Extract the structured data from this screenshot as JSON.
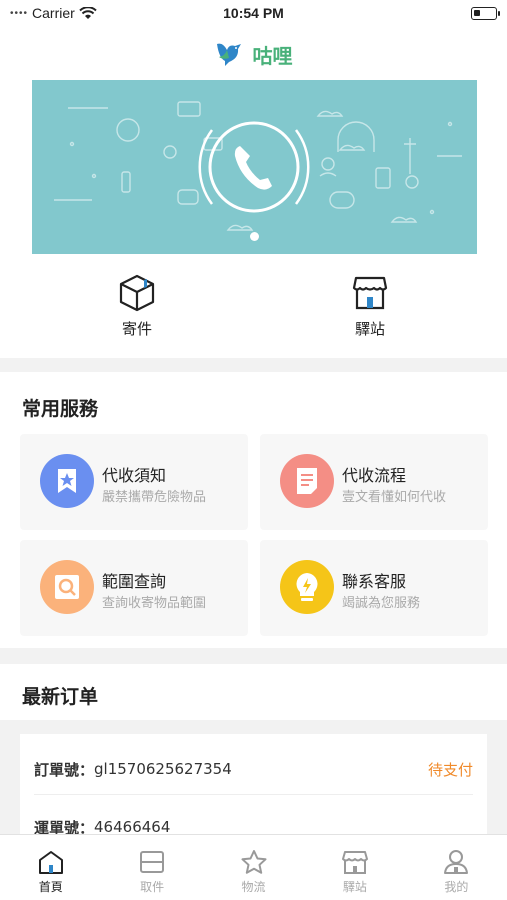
{
  "status_bar": {
    "carrier": "Carrier",
    "time": "10:54 PM"
  },
  "header": {
    "title": "咕哩",
    "logo_icon": "bird-logo-icon"
  },
  "quick_actions": [
    {
      "label": "寄件",
      "icon": "package-box-icon"
    },
    {
      "label": "驛站",
      "icon": "store-icon"
    }
  ],
  "services": {
    "title": "常用服務",
    "items": [
      {
        "name": "代收須知",
        "desc": "嚴禁攜帶危險物品",
        "icon": "bookmark-star-icon",
        "color": "#6a8ff0"
      },
      {
        "name": "代收流程",
        "desc": "壹文看懂如何代收",
        "icon": "document-icon",
        "color": "#f48e85"
      },
      {
        "name": "範圍查詢",
        "desc": "查詢收寄物品範圍",
        "icon": "search-icon",
        "color": "#fbb27b"
      },
      {
        "name": "聯系客服",
        "desc": "竭誠為您服務",
        "icon": "lightbulb-icon",
        "color": "#f5c518"
      }
    ]
  },
  "orders": {
    "title": "最新订单",
    "items": [
      {
        "order_label": "訂單號：",
        "order_no": "gl1570625627354",
        "status": "待支付",
        "waybill_label": "運單號：",
        "waybill_no": "46466464"
      }
    ]
  },
  "tabbar": [
    {
      "label": "首頁",
      "icon": "home-icon",
      "active": true
    },
    {
      "label": "取件",
      "icon": "pickup-icon",
      "active": false
    },
    {
      "label": "物流",
      "icon": "star-icon",
      "active": false
    },
    {
      "label": "驛站",
      "icon": "store-icon",
      "active": false
    },
    {
      "label": "我的",
      "icon": "user-icon",
      "active": false
    }
  ],
  "colors": {
    "brand_green": "#49b17a",
    "banner_teal": "#82c8cd",
    "status_orange": "#f08a2a"
  }
}
